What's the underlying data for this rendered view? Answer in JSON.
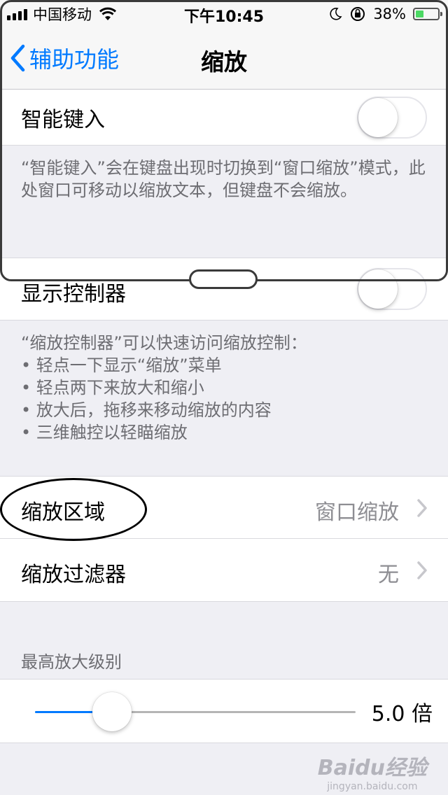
{
  "status_bar": {
    "carrier": "中国移动",
    "time": "下午10:45",
    "battery_percent_text": "38%",
    "battery_level": 0.38,
    "battery_color": "#4cd964",
    "icons": [
      "signal-icon",
      "wifi-icon",
      "moon-icon",
      "rotation-lock-icon",
      "battery-icon"
    ]
  },
  "nav": {
    "back_label": "辅助功能",
    "title": "缩放",
    "accent_color": "#007aff"
  },
  "smart_typing": {
    "label": "智能键入",
    "on": false,
    "footer": "“智能键入”会在键盘出现时切换到“窗口缩放”模式，此处窗口可移动以缩放文本，但键盘不会缩放。"
  },
  "show_controller": {
    "label": "显示控制器",
    "on": false,
    "footer_lines": [
      "“缩放控制器”可以快速访问缩放控制：",
      "• 轻点一下显示“缩放”菜单",
      "• 轻点两下来放大和缩小",
      "• 放大后，拖移来移动缩放的内容",
      "• 三维触控以轻瞄缩放"
    ]
  },
  "zoom_region": {
    "label": "缩放区域",
    "value": "窗口缩放"
  },
  "zoom_filter": {
    "label": "缩放过滤器",
    "value": "无"
  },
  "max_zoom": {
    "header": "最高放大级别",
    "value_text": "5.0 倍",
    "level": 0.24
  },
  "watermark": {
    "main": "Baidu经验",
    "sub": "jingyan.baidu.com"
  }
}
